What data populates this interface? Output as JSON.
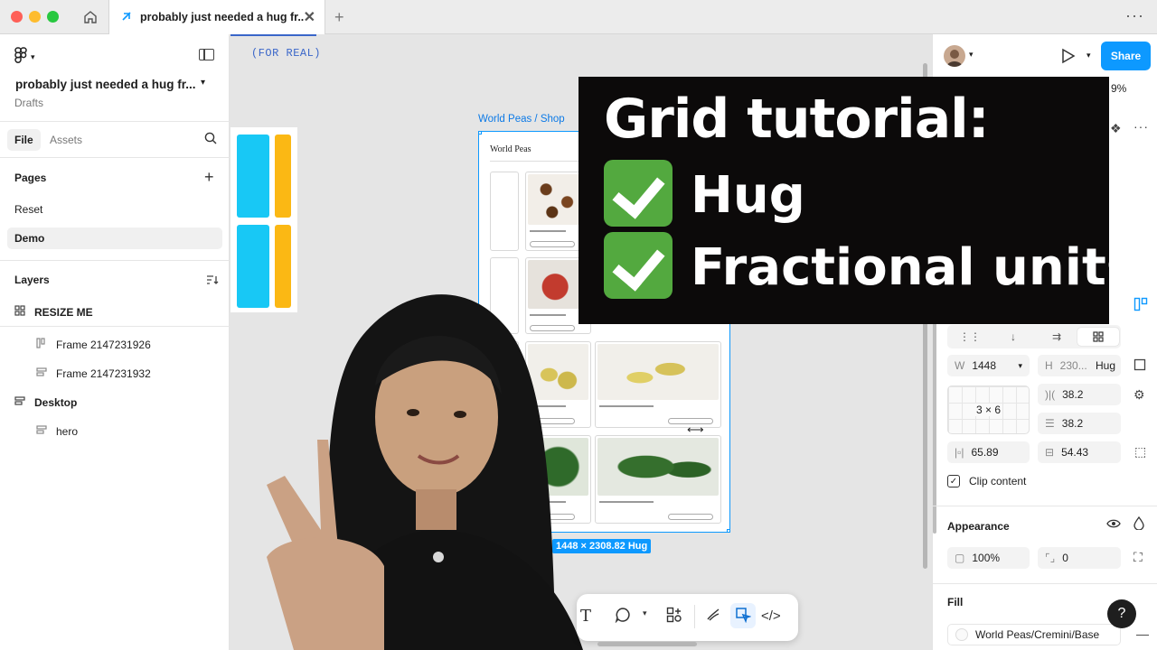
{
  "window": {
    "tab_title": "probably just needed a hug fr...",
    "new_tab": "+",
    "more": "···"
  },
  "left_panel": {
    "file_name": "probably just needed a hug fr...",
    "location": "Drafts",
    "tabs": {
      "file": "File",
      "assets": "Assets"
    },
    "pages_title": "Pages",
    "pages": [
      "Reset",
      "Demo"
    ],
    "active_page": "Demo",
    "layers_title": "Layers",
    "layers": [
      {
        "label": "RESIZE ME",
        "icon": "grid-icon"
      },
      {
        "label": "Frame 2147231926",
        "icon": "columns-icon"
      },
      {
        "label": "Frame 2147231932",
        "icon": "rows-icon"
      },
      {
        "label": "Desktop",
        "icon": "rows-icon"
      },
      {
        "label": "hero",
        "icon": "rows-icon"
      }
    ]
  },
  "canvas": {
    "annotation": "(FOR REAL)",
    "frame_label": "World Peas / Shop",
    "shop_logo": "World Peas",
    "size_badge": "1448 × 2308.82 Hug",
    "colors": {
      "cyan": "#18c8f5",
      "amber": "#fbb814",
      "selection": "#0d99ff"
    }
  },
  "overlay": {
    "title": "Grid tutorial:",
    "items": [
      "Hug",
      "Fractional units"
    ]
  },
  "right_panel": {
    "share": "Share",
    "zoom": "9%",
    "width_label": "W",
    "width_value": "1448",
    "height_label": "H",
    "height_value": "230...",
    "height_mode": "Hug",
    "grid_size": "3 × 6",
    "col_gap": "38.2",
    "row_gap": "38.2",
    "pad_h": "65.89",
    "pad_v": "54.43",
    "clip_content": "Clip content",
    "appearance_title": "Appearance",
    "opacity": "100%",
    "radius": "0",
    "fill_title": "Fill",
    "fill_value": "World Peas/Cremini/Base",
    "help": "?"
  }
}
